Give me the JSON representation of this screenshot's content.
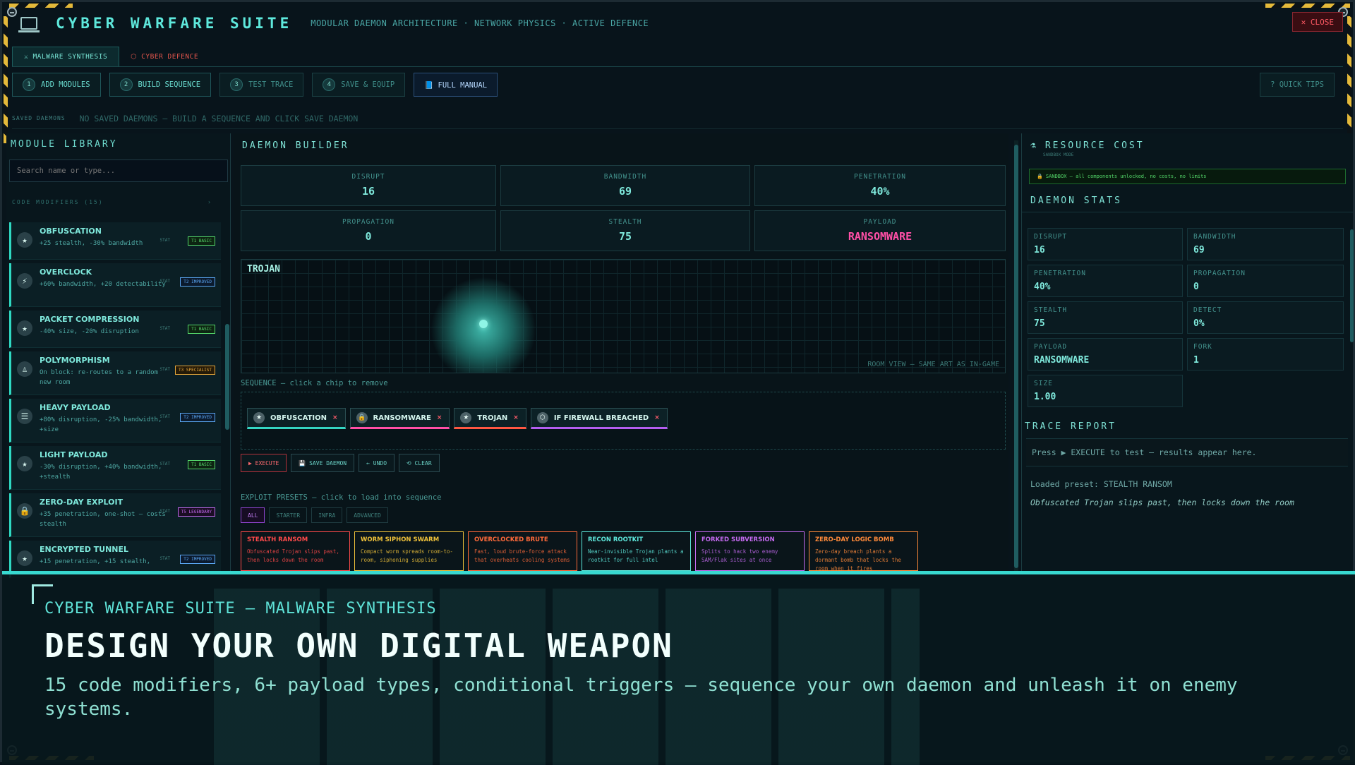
{
  "header": {
    "title": "CYBER WARFARE SUITE",
    "subtitle": "MODULAR DAEMON ARCHITECTURE · NETWORK PHYSICS · ACTIVE DEFENCE",
    "close_label": "✕ CLOSE"
  },
  "tabs": [
    {
      "label": "⚔ MALWARE SYNTHESIS"
    },
    {
      "label": "⬡ CYBER DEFENCE"
    }
  ],
  "toolbar": {
    "steps": [
      {
        "num": "1",
        "label": "ADD MODULES"
      },
      {
        "num": "2",
        "label": "BUILD SEQUENCE"
      },
      {
        "num": "3",
        "label": "TEST TRACE"
      },
      {
        "num": "4",
        "label": "SAVE & EQUIP"
      }
    ],
    "manual_label": "📘 FULL MANUAL",
    "tips_label": "? QUICK TIPS"
  },
  "saved": {
    "label": "SAVED DAEMONS",
    "text": "NO SAVED DAEMONS — BUILD A SEQUENCE AND CLICK SAVE DAEMON"
  },
  "library": {
    "title": "MODULE LIBRARY",
    "search_placeholder": "Search name or type...",
    "section_label": "CODE MODIFIERS (15)",
    "section_toggle": "›",
    "modules": [
      {
        "icon": "★",
        "name": "OBFUSCATION",
        "desc": "+25 stealth, -30% bandwidth",
        "stat": "STAT",
        "tier": "T1 BASIC",
        "tier_class": "t1"
      },
      {
        "icon": "⚡",
        "name": "OVERCLOCK",
        "desc": "+60% bandwidth, +20 detectability",
        "stat": "STAT",
        "tier": "T2 IMPROVED",
        "tier_class": "t2"
      },
      {
        "icon": "★",
        "name": "PACKET COMPRESSION",
        "desc": "-40% size, -20% disruption",
        "stat": "STAT",
        "tier": "T1 BASIC",
        "tier_class": "t1"
      },
      {
        "icon": "♙",
        "name": "POLYMORPHISM",
        "desc": "On block: re-routes to a random new room",
        "stat": "STAT",
        "tier": "T3 SPECIALIST",
        "tier_class": "t3"
      },
      {
        "icon": "☰",
        "name": "HEAVY PAYLOAD",
        "desc": "+80% disruption, -25% bandwidth, +size",
        "stat": "STAT",
        "tier": "T2 IMPROVED",
        "tier_class": "t2"
      },
      {
        "icon": "★",
        "name": "LIGHT PAYLOAD",
        "desc": "-30% disruption, +40% bandwidth, +stealth",
        "stat": "STAT",
        "tier": "T1 BASIC",
        "tier_class": "t1"
      },
      {
        "icon": "🔒",
        "name": "ZERO-DAY EXPLOIT",
        "desc": "+35 penetration, one-shot — costs stealth",
        "stat": "STAT",
        "tier": "T5 LEGENDARY",
        "tier_class": "t5"
      },
      {
        "icon": "★",
        "name": "ENCRYPTED TUNNEL",
        "desc": "+15 penetration, +15 stealth,",
        "stat": "STAT",
        "tier": "T2 IMPROVED",
        "tier_class": "t2"
      }
    ]
  },
  "builder": {
    "title": "DAEMON BUILDER",
    "stats": [
      {
        "label": "DISRUPT",
        "value": "16"
      },
      {
        "label": "BANDWIDTH",
        "value": "69"
      },
      {
        "label": "PENETRATION",
        "value": "40%"
      },
      {
        "label": "PROPAGATION",
        "value": "0"
      },
      {
        "label": "STEALTH",
        "value": "75"
      },
      {
        "label": "PAYLOAD",
        "value": "RANSOMWARE",
        "accent": "#ff4fa6"
      }
    ],
    "room_title": "TROJAN",
    "room_footer": "ROOM VIEW — SAME ART AS IN-GAME",
    "sequence_label": "SEQUENCE — click a chip to remove",
    "chips": [
      {
        "icon": "★",
        "label": "OBFUSCATION",
        "cls": "c1"
      },
      {
        "icon": "🔒",
        "label": "RANSOMWARE",
        "cls": "c2"
      },
      {
        "icon": "★",
        "label": "TROJAN",
        "cls": "c3"
      },
      {
        "icon": "⬡",
        "label": "IF FIREWALL BREACHED",
        "cls": "c4"
      }
    ],
    "chip_remove": "×",
    "actions": {
      "execute": "▶ EXECUTE",
      "save": "💾 SAVE DAEMON",
      "undo": "← UNDO",
      "clear": "⟲ CLEAR"
    },
    "presets_label": "EXPLOIT PRESETS — click to load into sequence",
    "filters": [
      "ALL",
      "STARTER",
      "INFRA",
      "ADVANCED"
    ],
    "presets": [
      {
        "title": "STEALTH RANSOM",
        "desc": "Obfuscated Trojan slips past, then locks down the room",
        "color": "#ff4a4a"
      },
      {
        "title": "WORM SIPHON SWARM",
        "desc": "Compact worm spreads room-to-room, siphoning supplies",
        "color": "#f0c23a"
      },
      {
        "title": "OVERCLOCKED BRUTE",
        "desc": "Fast, loud brute-force attack that overheats cooling systems",
        "color": "#ff6a3a"
      },
      {
        "title": "RECON ROOTKIT",
        "desc": "Near-invisible Trojan plants a rootkit for full intel",
        "color": "#5ee8dc"
      },
      {
        "title": "FORKED SUBVERSION",
        "desc": "Splits to hack two enemy SAM/Flak sites at once",
        "color": "#c46af0"
      },
      {
        "title": "ZERO-DAY LOGIC BOMB",
        "desc": "Zero-day breach plants a dormant bomb that locks the room when it fires",
        "color": "#ff8a3a"
      }
    ]
  },
  "resource": {
    "title": "RESOURCE COST",
    "mode": "SANDBOX MODE",
    "sandbox_note": "🔒 SANDBOX — all components unlocked, no costs, no limits"
  },
  "daemon_stats": {
    "title": "DAEMON STATS",
    "cells": [
      {
        "label": "DISRUPT",
        "value": "16"
      },
      {
        "label": "BANDWIDTH",
        "value": "69"
      },
      {
        "label": "PENETRATION",
        "value": "40%"
      },
      {
        "label": "PROPAGATION",
        "value": "0"
      },
      {
        "label": "STEALTH",
        "value": "75"
      },
      {
        "label": "DETECT",
        "value": "0%"
      },
      {
        "label": "PAYLOAD",
        "value": "RANSOMWARE"
      },
      {
        "label": "FORK",
        "value": "1"
      },
      {
        "label": "SIZE",
        "value": "1.00"
      }
    ]
  },
  "trace": {
    "title": "TRACE REPORT",
    "hint": "Press ▶ EXECUTE to test — results appear here.",
    "preset_line": "Loaded preset: STEALTH RANSOM",
    "preset_desc": "Obfuscated Trojan slips past, then locks down the room"
  },
  "overlay": {
    "kicker": "CYBER WARFARE SUITE — MALWARE SYNTHESIS",
    "title": "DESIGN YOUR OWN DIGITAL WEAPON",
    "desc": "15 code modifiers, 6+ payload types, conditional triggers — sequence your own daemon and unleash it on enemy systems."
  }
}
